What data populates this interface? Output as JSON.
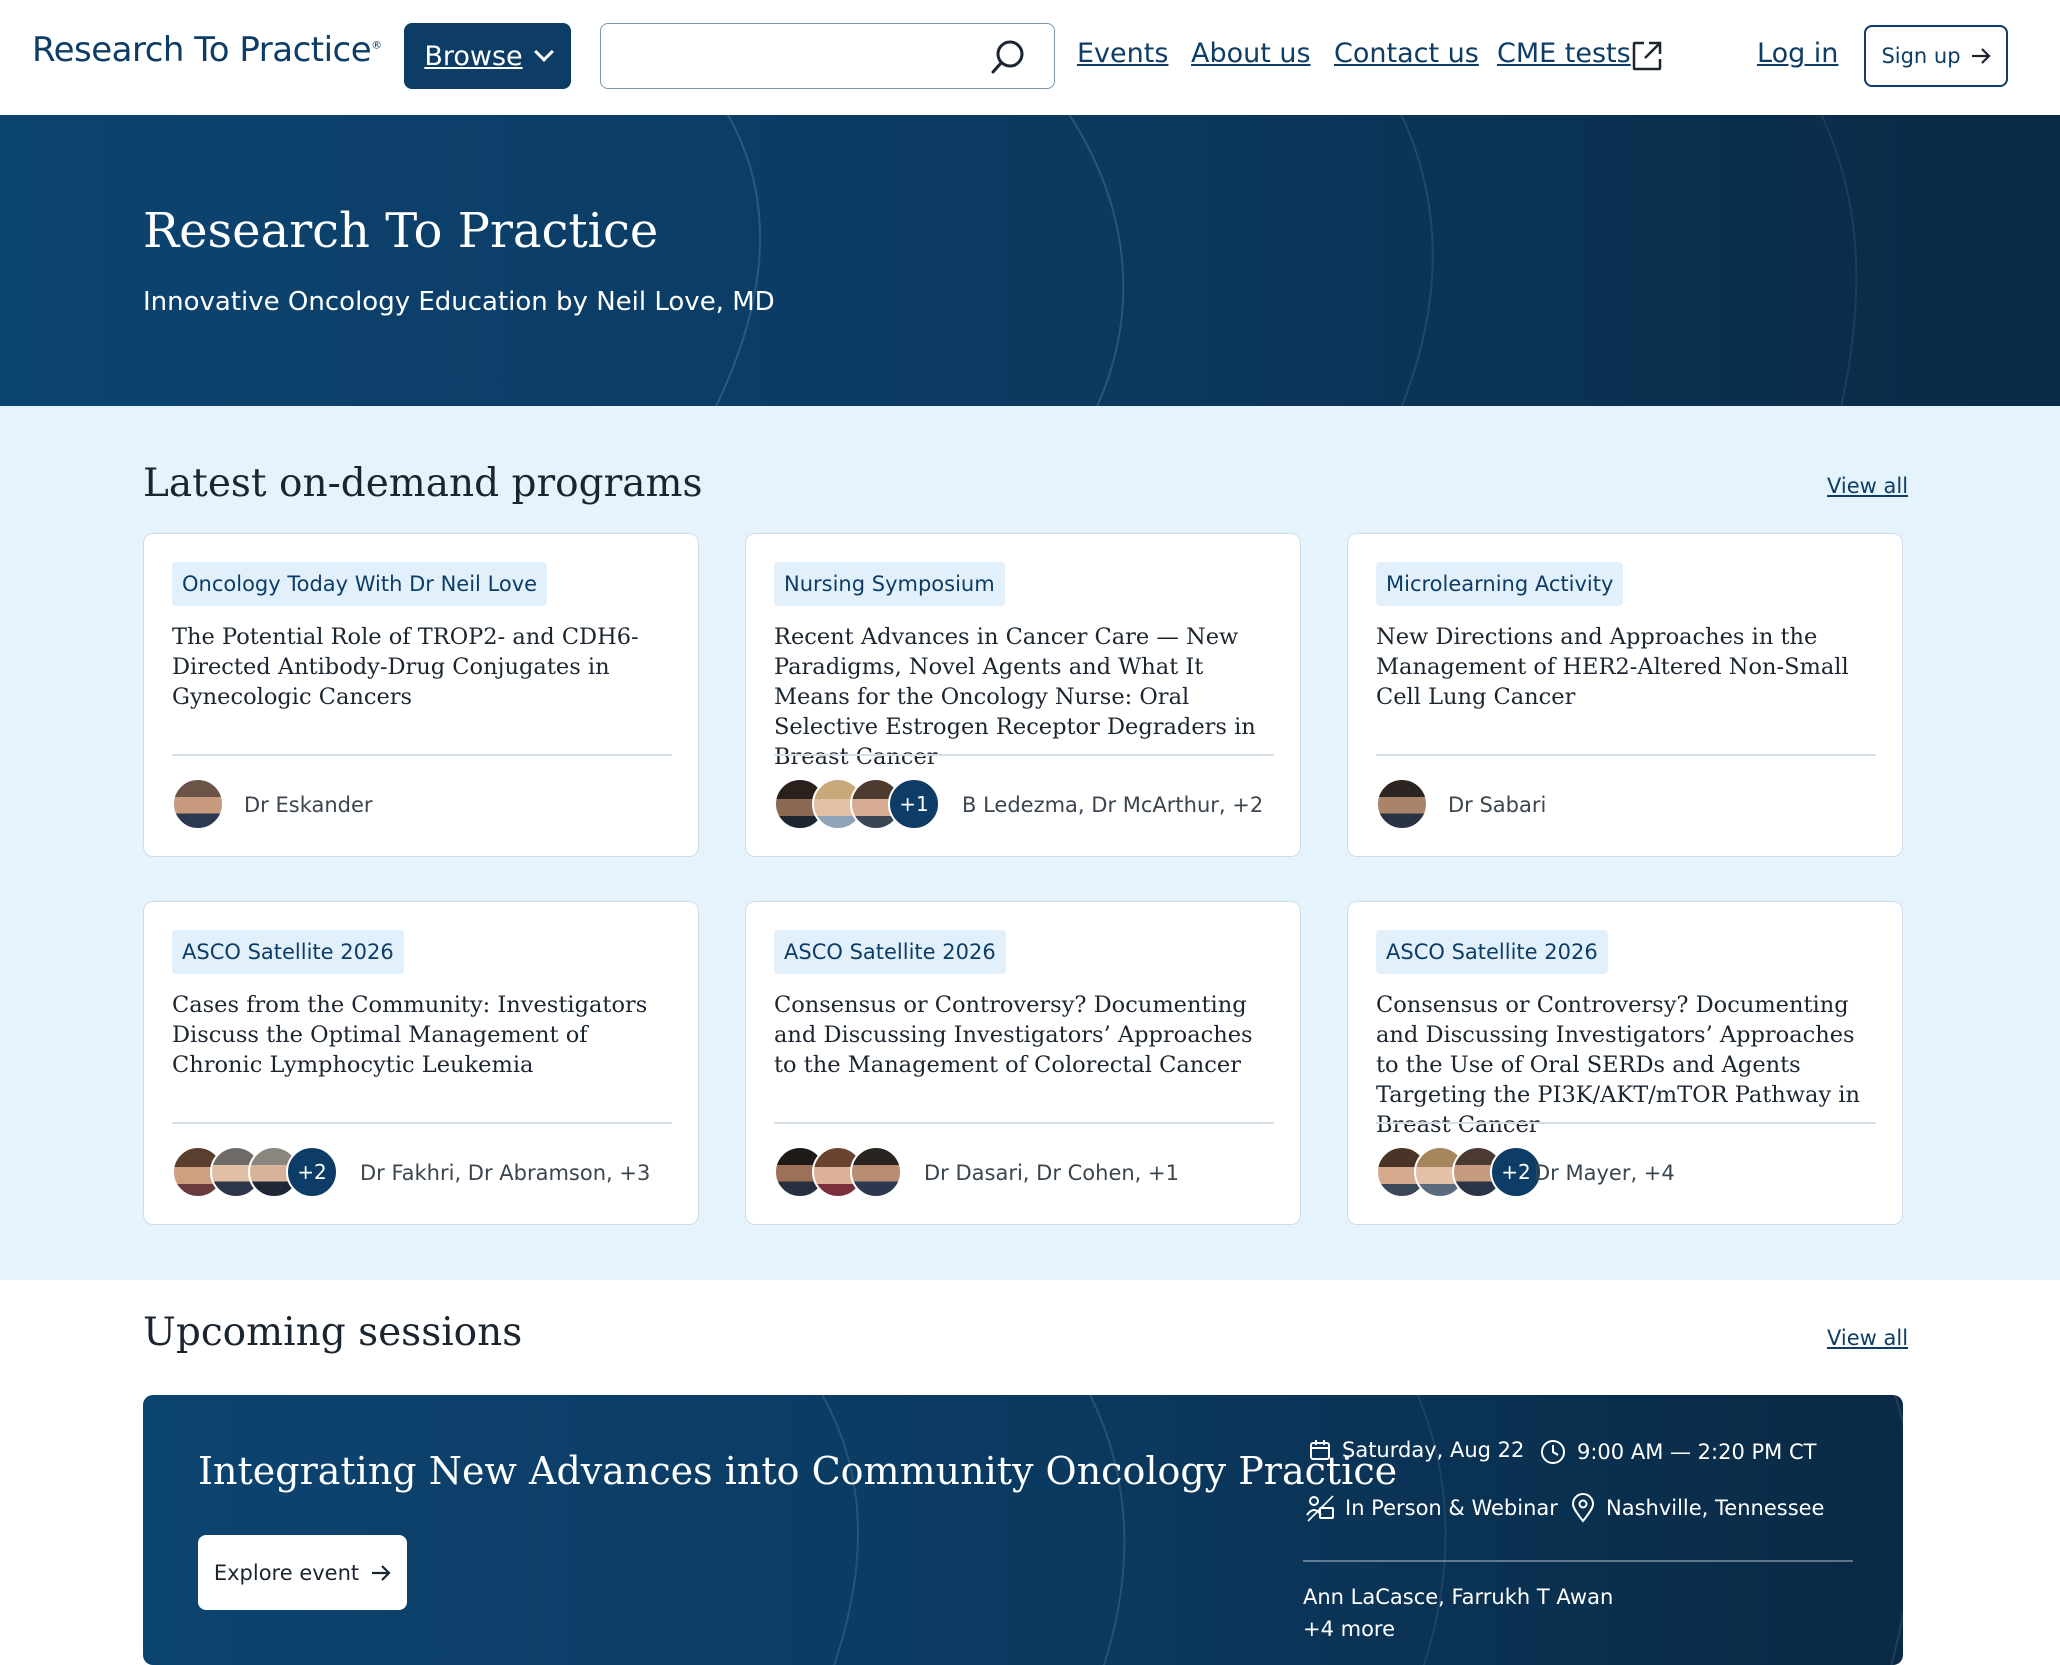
{
  "header": {
    "logo_text": "Research To Practice",
    "browse_label": "Browse",
    "search": {
      "placeholder": "",
      "value": ""
    },
    "nav": [
      {
        "label": "Events"
      },
      {
        "label": "About us"
      },
      {
        "label": "Contact us"
      },
      {
        "label": "CME tests"
      }
    ],
    "login_label": "Log in",
    "signup_label": "Sign up"
  },
  "hero": {
    "title": "Research To Practice",
    "subtitle": "Innovative Oncology Education by Neil Love, MD"
  },
  "ondemand": {
    "title": "Latest on-demand programs",
    "view_all": "View all",
    "cards": [
      {
        "tag": "Oncology Today With Dr Neil Love",
        "title": "The Potential Role of TROP2- and CDH6-Directed Antibody-Drug Conjugates in Gynecologic Cancers",
        "presenters": "Dr Eskander",
        "more": ""
      },
      {
        "tag": "Nursing Symposium",
        "title": "Recent Advances in Cancer Care — New Paradigms, Novel Agents and What It Means for the Oncology Nurse: Oral Selective Estrogen Receptor Degraders in Breast Cancer",
        "presenters": "B Ledezma, Dr McArthur, +2",
        "more": "+1"
      },
      {
        "tag": "Microlearning Activity",
        "title": "New Directions and Approaches in the Management of HER2-Altered Non-Small Cell Lung Cancer",
        "presenters": "Dr Sabari",
        "more": ""
      },
      {
        "tag": "ASCO Satellite 2026",
        "title": "Cases from the Community: Investigators Discuss the Optimal Management of Chronic Lymphocytic Leukemia",
        "presenters": "Dr Fakhri, Dr Abramson, +3",
        "more": "+2"
      },
      {
        "tag": "ASCO Satellite 2026",
        "title": "Consensus or Controversy? Documenting and Discussing Investigators’ Approaches to the Management of Colorectal Cancer",
        "presenters": "Dr Dasari, Dr Cohen, +1",
        "more": ""
      },
      {
        "tag": "ASCO Satellite 2026",
        "title": "Consensus or Controversy? Documenting and Discussing Investigators’ Approaches to the Use of Oral SERDs and Agents Targeting the PI3K/AKT/mTOR Pathway in Breast Cancer",
        "presenters": "Dr Mayer, +4",
        "more": "+2"
      }
    ]
  },
  "upcoming": {
    "title": "Upcoming sessions",
    "view_all": "View all",
    "event": {
      "title": "Integrating New Advances into Community Oncology Practice",
      "explore_label": "Explore event",
      "date": "Saturday, Aug 22",
      "time": "9:00 AM — 2:20 PM CT",
      "format": "In Person & Webinar",
      "location": "Nashville, Tennessee",
      "hosts": "Ann LaCasce, Farrukh T Awan",
      "hosts_more": "+4 more"
    }
  },
  "colors": {
    "brand_navy": "#0d3d66",
    "section_bg": "#e5f3fc",
    "tag_bg": "#e2f0fb"
  }
}
